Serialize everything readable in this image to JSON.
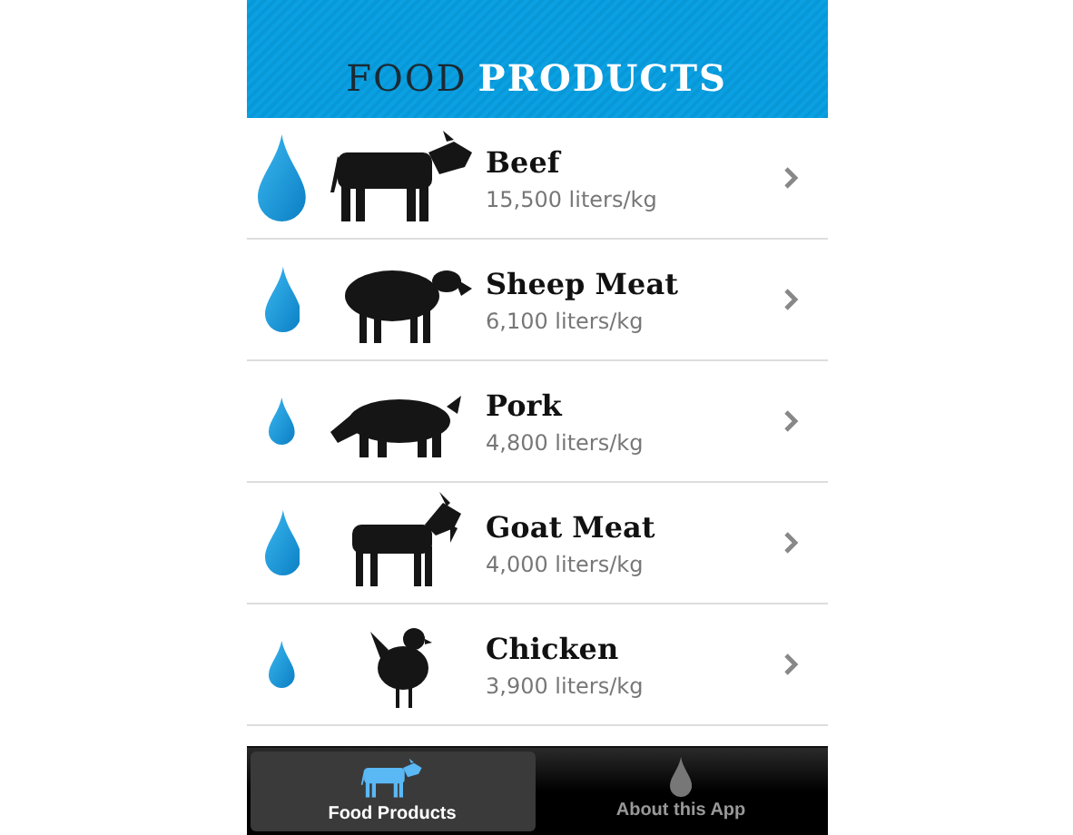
{
  "header": {
    "title_first": "FOOD",
    "title_second": "PRODUCTS"
  },
  "products": [
    {
      "name": "Beef",
      "amount": "15,500 liters/kg",
      "drop": {
        "kind": "large"
      },
      "kind": "cow"
    },
    {
      "name": "Sheep Meat",
      "amount": "6,100 liters/kg",
      "drop": {
        "kind": "medium"
      },
      "kind": "sheep"
    },
    {
      "name": "Pork",
      "amount": "4,800 liters/kg",
      "drop": {
        "kind": "small"
      },
      "kind": "pig"
    },
    {
      "name": "Goat Meat",
      "amount": "4,000 liters/kg",
      "drop": {
        "kind": "medium"
      },
      "kind": "goat"
    },
    {
      "name": "Chicken",
      "amount": "3,900 liters/kg",
      "drop": {
        "kind": "small"
      },
      "kind": "chicken"
    }
  ],
  "tabs": [
    {
      "label": "Food Products",
      "selected": true,
      "kind": "cow"
    },
    {
      "label": "About this App",
      "selected": false,
      "kind": "drop"
    }
  ]
}
